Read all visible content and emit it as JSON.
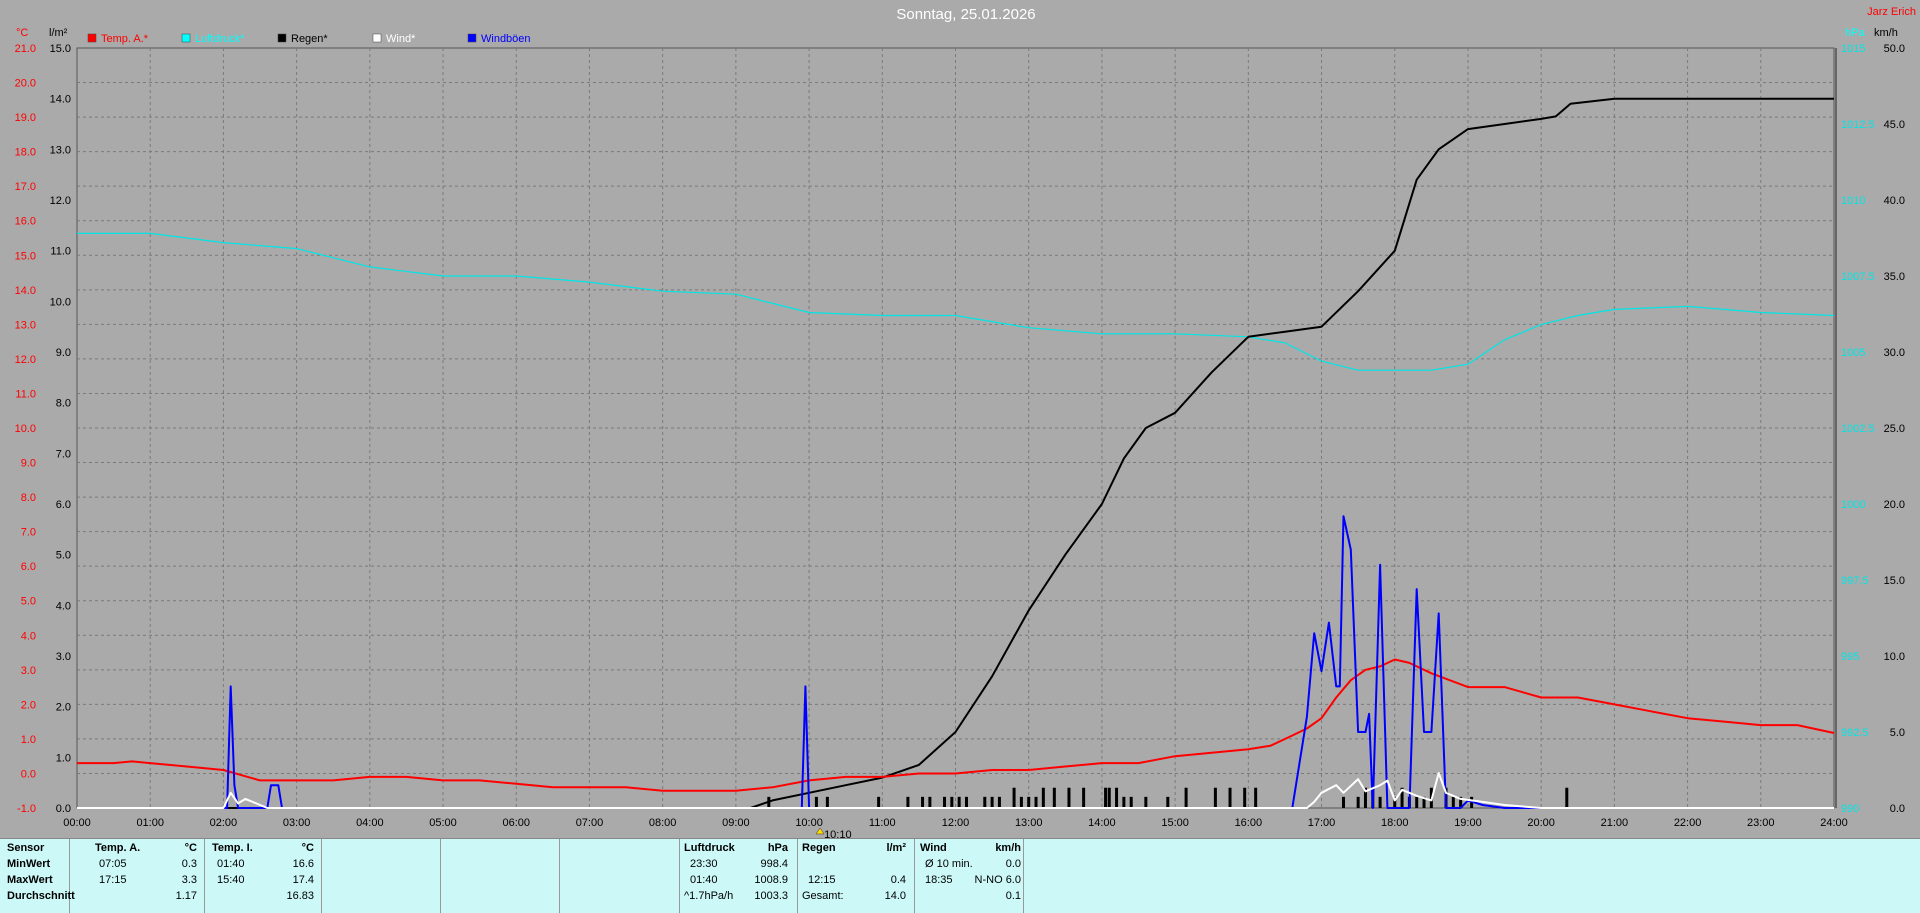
{
  "header": {
    "title": "Sonntag, 25.01.2026",
    "station": "Jarz Erich",
    "unit_temp": "°C",
    "unit_rain": "l/m²",
    "unit_pressure": "hPa",
    "unit_wind": "km/h"
  },
  "legend": [
    {
      "label": "Temp. A.*",
      "color": "#ff0000"
    },
    {
      "label": "Luftdruck*",
      "color": "#00ffff"
    },
    {
      "label": "Regen*",
      "color": "#000000"
    },
    {
      "label": "Wind*",
      "color": "#ffffff"
    },
    {
      "label": "Windböen",
      "color": "#0000ff"
    }
  ],
  "chart_data": {
    "type": "line",
    "title": "Sonntag, 25.01.2026",
    "x_ticks": [
      "00:00",
      "01:00",
      "02:00",
      "03:00",
      "04:00",
      "05:00",
      "06:00",
      "07:00",
      "08:00",
      "09:00",
      "10:00",
      "11:00",
      "12:00",
      "13:00",
      "14:00",
      "15:00",
      "16:00",
      "17:00",
      "18:00",
      "19:00",
      "20:00",
      "21:00",
      "22:00",
      "23:00",
      "24:00"
    ],
    "xlim": [
      0,
      24
    ],
    "axes": {
      "temp": {
        "unit": "°C",
        "ylim": [
          -1,
          21
        ],
        "ticks": [
          "21.0",
          "20.0",
          "19.0",
          "18.0",
          "17.0",
          "16.0",
          "15.0",
          "14.0",
          "13.0",
          "12.0",
          "11.0",
          "10.0",
          "9.0",
          "8.0",
          "7.0",
          "6.0",
          "5.0",
          "4.0",
          "3.0",
          "2.0",
          "1.0",
          "0.0",
          "-1.0"
        ]
      },
      "rain": {
        "unit": "l/m²",
        "ylim": [
          0,
          15
        ],
        "ticks": [
          "15.0",
          "14.0",
          "13.0",
          "12.0",
          "11.0",
          "10.0",
          "9.0",
          "8.0",
          "7.0",
          "6.0",
          "5.0",
          "4.0",
          "3.0",
          "2.0",
          "1.0",
          "0.0"
        ]
      },
      "pressure": {
        "unit": "hPa",
        "ylim": [
          990,
          1015
        ],
        "ticks": [
          "1015",
          "1012.5",
          "1010",
          "1007.5",
          "1005",
          "1002.5",
          "1000",
          "997.5",
          "995",
          "992.5",
          "990"
        ]
      },
      "wind": {
        "unit": "km/h",
        "ylim": [
          0,
          50
        ],
        "ticks": [
          "50.0",
          "45.0",
          "40.0",
          "35.0",
          "30.0",
          "25.0",
          "20.0",
          "15.0",
          "10.0",
          "5.0",
          "0.0"
        ]
      }
    },
    "grid": true,
    "legend_position": "top-left",
    "series": [
      {
        "name": "Temp. A.*",
        "axis": "temp",
        "color": "#ff0000",
        "x": [
          0,
          0.5,
          0.75,
          1,
          1.5,
          2,
          2.5,
          3,
          3.5,
          4,
          4.5,
          5,
          5.5,
          6,
          6.5,
          7,
          7.5,
          8,
          8.5,
          9,
          9.5,
          10,
          10.5,
          11,
          11.5,
          12,
          12.5,
          13,
          13.5,
          14,
          14.5,
          15,
          15.5,
          16,
          16.3,
          16.6,
          16.8,
          17,
          17.2,
          17.4,
          17.6,
          17.8,
          18,
          18.2,
          18.5,
          19,
          19.5,
          20,
          20.5,
          21,
          21.5,
          22,
          22.5,
          23,
          23.5,
          24
        ],
        "y": [
          0.3,
          0.3,
          0.35,
          0.3,
          0.2,
          0.1,
          -0.2,
          -0.2,
          -0.2,
          -0.1,
          -0.1,
          -0.2,
          -0.2,
          -0.3,
          -0.4,
          -0.4,
          -0.4,
          -0.5,
          -0.5,
          -0.5,
          -0.4,
          -0.2,
          -0.1,
          -0.1,
          0,
          0,
          0.1,
          0.1,
          0.2,
          0.3,
          0.3,
          0.5,
          0.6,
          0.7,
          0.8,
          1.1,
          1.3,
          1.6,
          2.2,
          2.7,
          3.0,
          3.1,
          3.3,
          3.2,
          2.9,
          2.5,
          2.5,
          2.2,
          2.2,
          2.0,
          1.8,
          1.6,
          1.5,
          1.4,
          1.4,
          1.17
        ]
      },
      {
        "name": "Luftdruck*",
        "axis": "pressure",
        "color": "#00e6e6",
        "x": [
          0,
          1,
          2,
          3,
          4,
          5,
          6,
          7,
          8,
          9,
          10,
          11,
          12,
          13,
          14,
          15,
          16,
          16.5,
          17,
          17.5,
          18,
          18.5,
          19,
          19.5,
          20,
          20.5,
          21,
          22,
          22.5,
          23,
          24
        ],
        "y": [
          1008.9,
          1008.9,
          1008.6,
          1008.4,
          1007.8,
          1007.5,
          1007.5,
          1007.3,
          1007,
          1006.9,
          1006.3,
          1006.2,
          1006.2,
          1005.8,
          1005.6,
          1005.6,
          1005.5,
          1005.3,
          1004.7,
          1004.4,
          1004.4,
          1004.4,
          1004.6,
          1005.4,
          1005.9,
          1006.2,
          1006.4,
          1006.5,
          1006.4,
          1006.3,
          1006.2
        ]
      },
      {
        "name": "Regen*",
        "axis": "rain",
        "color": "#000000",
        "x": [
          0,
          9.2,
          9.5,
          10,
          10.5,
          11,
          11.5,
          12,
          12.5,
          13,
          13.5,
          14,
          14.3,
          14.6,
          15,
          15.5,
          16,
          16.5,
          17,
          17.5,
          18,
          18.3,
          18.6,
          19,
          19.5,
          20,
          20.2,
          20.4,
          21,
          22,
          23,
          24
        ],
        "y": [
          0,
          0,
          0.15,
          0.3,
          0.45,
          0.6,
          0.85,
          1.5,
          2.6,
          3.9,
          5.0,
          6.0,
          6.9,
          7.5,
          7.8,
          8.6,
          9.3,
          9.4,
          9.5,
          10.2,
          11.0,
          12.4,
          13.0,
          13.4,
          13.5,
          13.6,
          13.65,
          13.9,
          14.0,
          14.0,
          14.0,
          14.0
        ]
      },
      {
        "name": "Wind*",
        "axis": "wind",
        "color": "#ffffff",
        "x": [
          0,
          2,
          2.1,
          2.2,
          2.3,
          2.6,
          3,
          16.8,
          16.9,
          17,
          17.2,
          17.3,
          17.5,
          17.6,
          17.8,
          17.9,
          18,
          18.1,
          18.3,
          18.5,
          18.6,
          18.7,
          18.9,
          19.2,
          19.5,
          20,
          24
        ],
        "y": [
          0,
          0,
          1,
          0.3,
          0.6,
          0,
          0,
          0,
          0.4,
          1.0,
          1.5,
          1.0,
          1.9,
          1.1,
          1.5,
          1.8,
          0.5,
          1.2,
          0.8,
          0.5,
          2.3,
          1.0,
          0.6,
          0.4,
          0.2,
          0,
          0
        ]
      },
      {
        "name": "Windböen",
        "axis": "wind",
        "color": "#0000ff",
        "x": [
          0,
          2,
          2.05,
          2.1,
          2.15,
          2.2,
          2.6,
          2.65,
          2.75,
          2.8,
          2.85,
          9.8,
          9.9,
          9.95,
          10,
          10.05,
          10.1,
          16.6,
          16.8,
          16.9,
          17,
          17.1,
          17.2,
          17.25,
          17.3,
          17.4,
          17.5,
          17.6,
          17.65,
          17.7,
          17.8,
          17.9,
          18,
          18.1,
          18.2,
          18.3,
          18.4,
          18.5,
          18.6,
          18.7,
          18.8,
          18.9,
          19,
          19.2,
          19.5,
          24
        ],
        "y": [
          0,
          0,
          0,
          8.0,
          1.5,
          0,
          0,
          1.5,
          1.5,
          0,
          0,
          0,
          0,
          8.0,
          0,
          0,
          0,
          0,
          6.0,
          11.5,
          9.0,
          12.2,
          8.0,
          8.0,
          19.2,
          17.0,
          5.0,
          5.0,
          6.2,
          0,
          16.0,
          0,
          0,
          0,
          0,
          14.4,
          5.0,
          5.0,
          12.8,
          0,
          0,
          0,
          0.5,
          0.2,
          0,
          0
        ]
      }
    ],
    "rain_bars": {
      "axis": "rain",
      "color": "#000000",
      "x": [
        9.45,
        10.1,
        10.25,
        10.95,
        11.35,
        11.55,
        11.65,
        11.85,
        11.95,
        12.05,
        12.15,
        12.4,
        12.5,
        12.6,
        12.8,
        12.9,
        13,
        13.1,
        13.2,
        13.35,
        13.55,
        13.75,
        14.05,
        14.1,
        14.2,
        14.3,
        14.4,
        14.6,
        14.9,
        15.15,
        15.55,
        15.75,
        15.95,
        16.1,
        17.3,
        17.5,
        17.6,
        17.7,
        17.8,
        18,
        18.1,
        18.2,
        18.3,
        18.4,
        18.5,
        18.7,
        18.8,
        18.9,
        19.05,
        20.35
      ],
      "y": [
        0.22,
        0.22,
        0.22,
        0.22,
        0.22,
        0.22,
        0.22,
        0.22,
        0.22,
        0.22,
        0.22,
        0.22,
        0.22,
        0.22,
        0.4,
        0.22,
        0.22,
        0.22,
        0.4,
        0.4,
        0.4,
        0.4,
        0.4,
        0.4,
        0.4,
        0.22,
        0.22,
        0.22,
        0.22,
        0.4,
        0.4,
        0.4,
        0.4,
        0.4,
        0.22,
        0.22,
        0.4,
        0.4,
        0.22,
        0.22,
        0.4,
        0.22,
        0.22,
        0.22,
        0.4,
        0.4,
        0.22,
        0.22,
        0.22,
        0.4
      ]
    },
    "marker": {
      "label": "10:10",
      "x": 10.15
    }
  },
  "summary": {
    "sensor_header": "Sensor",
    "rows": [
      "MinWert",
      "MaxWert",
      "Durchschnitt"
    ],
    "temp_a": {
      "title": "Temp. A.",
      "unit": "°C",
      "min_time": "07:05",
      "min_val": "0.3",
      "max_time": "17:15",
      "max_val": "3.3",
      "avg": "1.17"
    },
    "temp_i": {
      "title": "Temp. I.",
      "unit": "°C",
      "min_time": "01:40",
      "min_val": "16.6",
      "max_time": "15:40",
      "max_val": "17.4",
      "avg": "16.83"
    },
    "pressure": {
      "title": "Luftdruck",
      "unit": "hPa",
      "min_time": "23:30",
      "min_val": "998.4",
      "max_time": "01:40",
      "max_val": "1008.9",
      "trend": "^1.7hPa/h",
      "avg": "1003.3"
    },
    "rain": {
      "title": "Regen",
      "unit": "l/m²",
      "max_time": "12:15",
      "max_val": "0.4",
      "total_label": "Gesamt:",
      "total": "14.0"
    },
    "wind": {
      "title": "Wind",
      "unit": "km/h",
      "avg_label": "Ø 10 min.",
      "avg_val": "0.0",
      "max_time": "18:35",
      "max_val": "N-NO 6.0",
      "avg": "0.1"
    }
  }
}
